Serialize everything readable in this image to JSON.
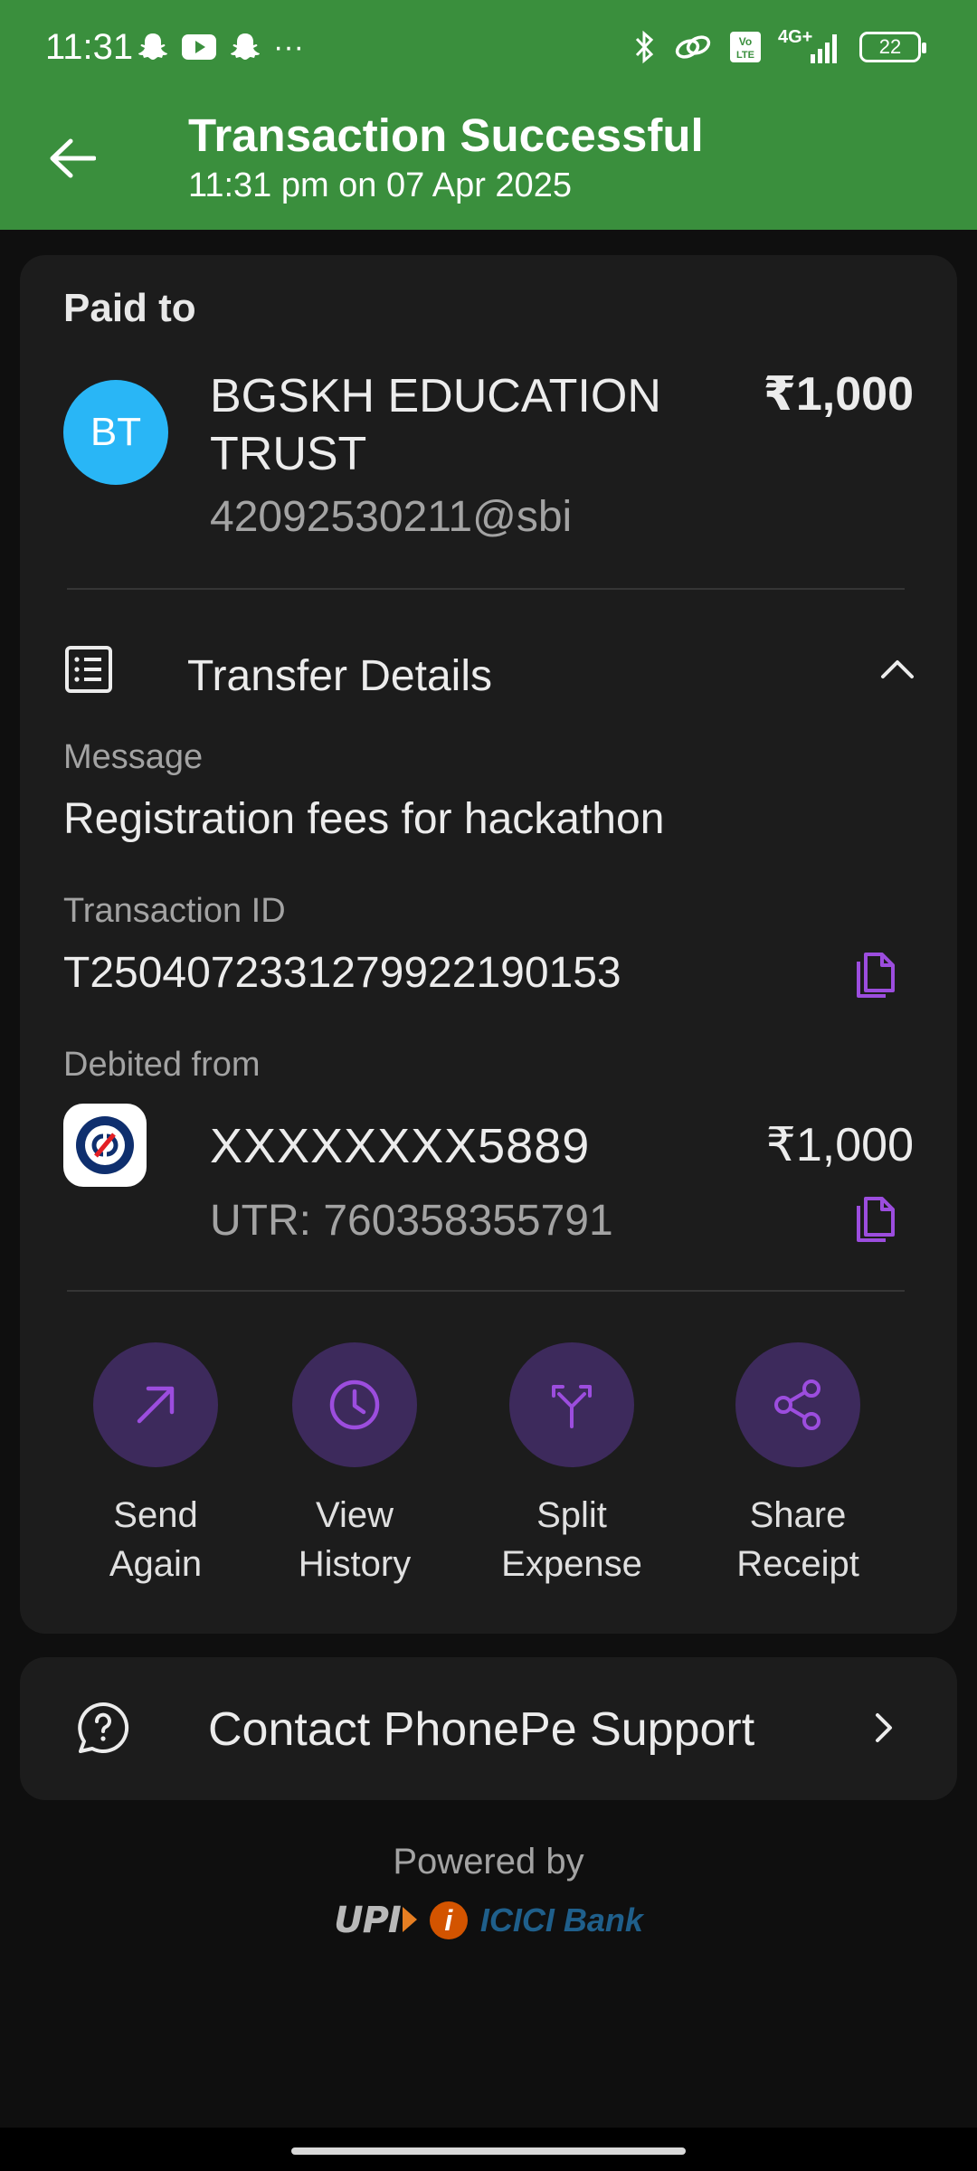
{
  "status_bar": {
    "time": "11:31",
    "more": "···",
    "battery": "22",
    "network": "4G+",
    "icons_left": [
      "snapchat-icon",
      "youtube-icon",
      "snapchat-icon"
    ],
    "icons_right": [
      "bluetooth-icon",
      "link-icon",
      "volte-icon",
      "signal-icon",
      "battery-icon"
    ]
  },
  "header": {
    "title": "Transaction Successful",
    "subtitle": "11:31 pm on 07 Apr 2025",
    "background": "#3a8f3d"
  },
  "payee": {
    "section_label": "Paid to",
    "initials": "BT",
    "name": "BGSKH EDUCATION TRUST",
    "upi_id": "42092530211@sbi",
    "amount": "₹1,000",
    "avatar_color": "#29b6f6"
  },
  "transfer_details": {
    "label": "Transfer Details",
    "expanded": true,
    "message_label": "Message",
    "message": "Registration fees for hackathon",
    "transaction_id_label": "Transaction ID",
    "transaction_id": "T2504072331279922190153",
    "debited_from_label": "Debited from",
    "account_number": "XXXXXXXX5889",
    "debited_amount": "₹1,000",
    "utr": "UTR: 760358355791"
  },
  "actions": [
    {
      "label": "Send Again",
      "icon": "arrow-up-right-icon"
    },
    {
      "label": "View History",
      "icon": "clock-icon"
    },
    {
      "label": "Split Expense",
      "icon": "split-icon"
    },
    {
      "label": "Share Receipt",
      "icon": "share-icon"
    }
  ],
  "support": {
    "label": "Contact PhonePe Support"
  },
  "footer": {
    "powered_by": "Powered by",
    "upi_logo_text": "UPI",
    "bank_logo_text": "ICICI Bank"
  },
  "colors": {
    "accent_purple": "#9c4dde",
    "action_bg": "#3d2a5c",
    "card_bg": "#1c1c1c"
  }
}
